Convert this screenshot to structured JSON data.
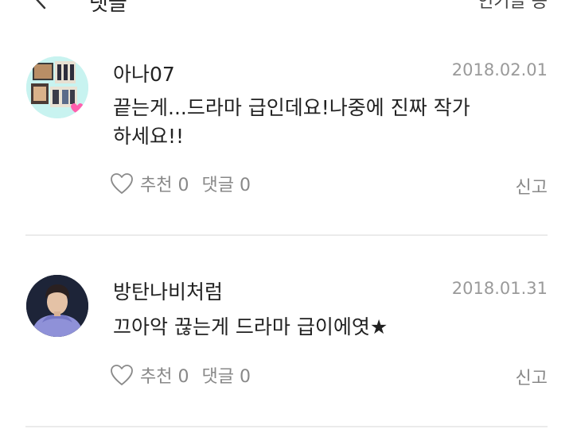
{
  "header": {
    "title": "댓글",
    "right_label": "인기글 등",
    "back_icon": "chevron-left-icon"
  },
  "comments": [
    {
      "author": "아나07",
      "date": "2018.02.01",
      "text_line1": "끝는게...드라마 급인데요!나중에 진짜 작가",
      "text_line2": "하세요!!",
      "like_label": "추천 0",
      "reply_label": "댓글 0",
      "report_label": "신고",
      "avatar_icon": "collage-avatar-icon"
    },
    {
      "author": "방탄나비처럼",
      "date": "2018.01.31",
      "text_line1": "끄아악 끊는게 드라마 급이에엿★",
      "like_label": "추천 0",
      "reply_label": "댓글 0",
      "report_label": "신고",
      "avatar_icon": "person-avatar-icon"
    }
  ],
  "colors": {
    "text": "#222222",
    "muted": "#888888",
    "date": "#9a9a9a",
    "divider": "#ebebeb",
    "avatar1_bg": "#c8f3f0",
    "avatar2_bg": "#8f91d8"
  }
}
